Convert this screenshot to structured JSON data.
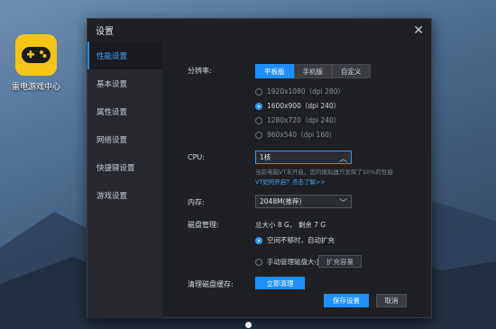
{
  "desktop": {
    "app_label": "雷电游戏中心",
    "app_color": "#f5c518"
  },
  "dialog": {
    "title": "设置",
    "close_glyph": "✕"
  },
  "sidebar": {
    "items": [
      {
        "label": "性能设置",
        "active": true
      },
      {
        "label": "基本设置"
      },
      {
        "label": "属性设置"
      },
      {
        "label": "网络设置"
      },
      {
        "label": "快捷键设置"
      },
      {
        "label": "游戏设置"
      }
    ]
  },
  "performance": {
    "resolution_label": "分辨率:",
    "modes": [
      "平板版",
      "手机版",
      "自定义"
    ],
    "selected_mode": "平板版",
    "resolutions": [
      {
        "label": "1920x1080（dpi 280）",
        "selected": false
      },
      {
        "label": "1600x900（dpi 240）",
        "selected": true
      },
      {
        "label": "1280x720（dpi 240）",
        "selected": false
      },
      {
        "label": "960x540（dpi 160）",
        "selected": false
      }
    ],
    "cpu_label": "CPU:",
    "cpu_value": "1核",
    "cpu_note": "当前电脑VT未开启，您的模拟器只发挥了10%的性能",
    "cpu_link": "VT如何开启？点击了解>>",
    "memory_label": "内存:",
    "memory_value": "2048M(推荐)",
    "disk_label": "磁盘管理:",
    "disk_info": "总大小 8 G， 剩余 7 G",
    "disk_auto": "空间不够时，自动扩充",
    "disk_manual": "手动管理磁盘大小",
    "expand_button": "扩充容量",
    "cache_label": "清理磁盘缓存:",
    "clean_button": "立即清理",
    "save_button": "保存设置",
    "cancel_button": "取消"
  },
  "colors": {
    "accent": "#1e90ff",
    "dialog_bg": "#1f2024",
    "sidebar_bg": "#26282d"
  }
}
